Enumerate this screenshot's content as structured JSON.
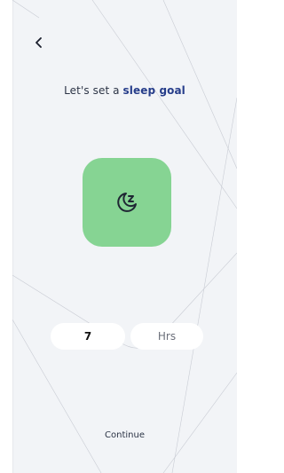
{
  "header": {
    "back_icon": "chevron-left-icon"
  },
  "prompt": {
    "prefix": "Let's set a",
    "highlight": "sleep goal"
  },
  "goal_tile": {
    "icon": "moon-sleep-icon",
    "color": "#86d493"
  },
  "duration": {
    "hours_value": "7",
    "unit_label": "Hrs"
  },
  "footer": {
    "continue_label": "Continue"
  },
  "colors": {
    "background": "#f2f4f7",
    "accent_text": "#263d8a",
    "tile_green": "#86d493"
  }
}
